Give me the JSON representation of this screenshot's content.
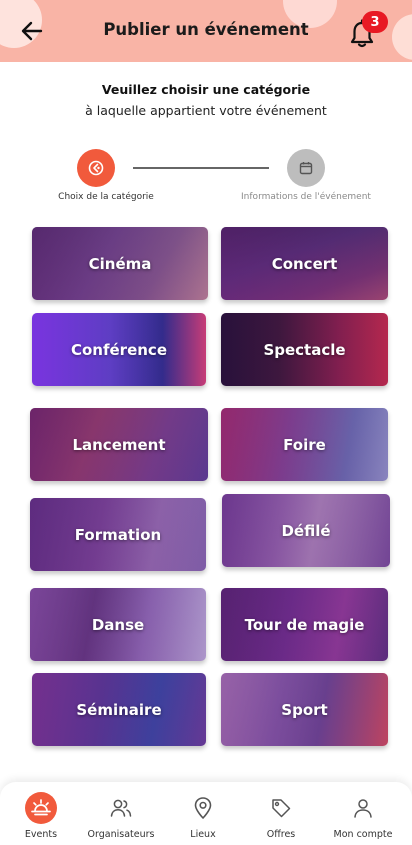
{
  "header": {
    "title": "Publier un événement",
    "notification_count": "3"
  },
  "intro": {
    "line1": "Veuillez choisir une catégorie",
    "line2": "à laquelle appartient votre événement"
  },
  "stepper": {
    "step1_label": "Choix de la catégorie",
    "step2_label": "Informations de l'événement"
  },
  "categories": [
    {
      "label": "Cinéma"
    },
    {
      "label": "Concert"
    },
    {
      "label": "Conférence"
    },
    {
      "label": "Spectacle"
    },
    {
      "label": "Lancement"
    },
    {
      "label": "Foire"
    },
    {
      "label": "Formation"
    },
    {
      "label": "Défilé"
    },
    {
      "label": "Danse"
    },
    {
      "label": "Tour de magie"
    },
    {
      "label": "Séminaire"
    },
    {
      "label": "Sport"
    }
  ],
  "bottom_nav": {
    "items": [
      {
        "label": "Events",
        "icon": "sunrise-icon",
        "active": true
      },
      {
        "label": "Organisateurs",
        "icon": "users-icon",
        "active": false
      },
      {
        "label": "Lieux",
        "icon": "location-pin-icon",
        "active": false
      },
      {
        "label": "Offres",
        "icon": "tag-icon",
        "active": false
      },
      {
        "label": "Mon compte",
        "icon": "user-icon",
        "active": false
      }
    ]
  },
  "colors": {
    "accent": "#f15a3c",
    "header_bg": "#f9b4a6",
    "badge": "#e81923",
    "inactive_step": "#bdbdbd"
  }
}
